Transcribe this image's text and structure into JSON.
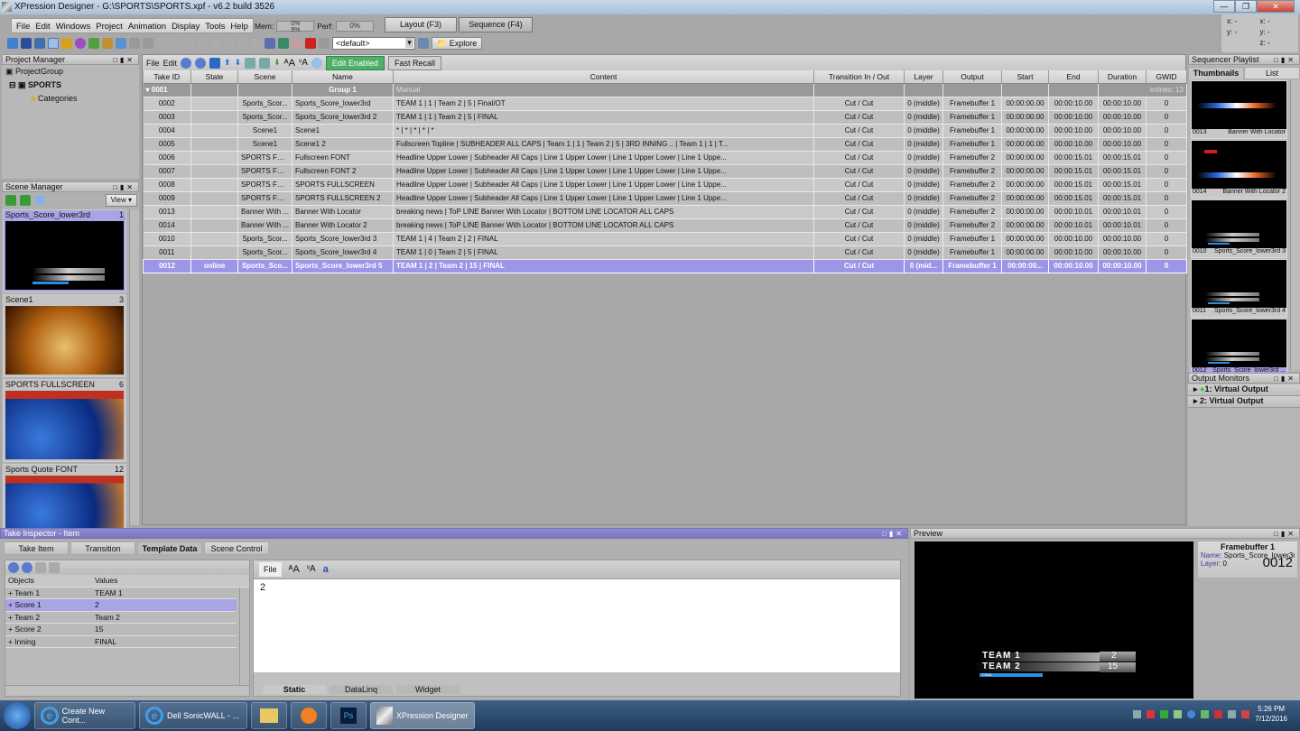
{
  "window": {
    "title": "XPression Designer - G:\\SPORTS\\SPORTS.xpf - v6.2 build 3526",
    "min": "—",
    "max": "❐",
    "close": "✕"
  },
  "menu": [
    "File",
    "Edit",
    "Windows",
    "Project",
    "Animation",
    "Display",
    "Tools",
    "Help"
  ],
  "meters": {
    "mem_label": "Mem:",
    "mem_top": "0%",
    "mem_bottom": "9%",
    "perf_label": "Perf:",
    "perf_value": "0%"
  },
  "modes": {
    "layout": "Layout (F3)",
    "sequence": "Sequence (F4)"
  },
  "toolbar": {
    "combo_value": "<default>",
    "explore": "Explore"
  },
  "coords": {
    "x1": "x: -",
    "x2": "x: -",
    "y1": "y: -",
    "y2": "y: -",
    "z2": "z: -"
  },
  "project_manager": {
    "title": "Project Manager",
    "items": [
      "ProjectGroup",
      "SPORTS",
      "Categories"
    ]
  },
  "scene_manager": {
    "title": "Scene Manager",
    "view": "View ▾",
    "scenes": [
      {
        "name": "Sports_Score_lower3rd",
        "num": "1"
      },
      {
        "name": "Scene1",
        "num": "3"
      },
      {
        "name": "SPORTS FULLSCREEN",
        "num": "6"
      },
      {
        "name": "Sports Quote FONT",
        "num": "12"
      }
    ]
  },
  "take_list": {
    "toolbar": {
      "file": "File",
      "edit": "Edit",
      "edit_enabled": "Edit Enabled",
      "fast_recall": "Fast Recall"
    },
    "columns": [
      "Take ID",
      "State",
      "Scene",
      "Name",
      "Content",
      "Transition In / Out",
      "Layer",
      "Output",
      "Start",
      "End",
      "Duration",
      "GWID"
    ],
    "group": {
      "id": "0001",
      "name": "Group 1",
      "content": "Manual",
      "entries": "entries: 13"
    },
    "rows": [
      [
        "0002",
        "",
        "Sports_Scor...",
        "Sports_Score_lower3rd",
        "TEAM 1 | 1 | Team 2 | 5 | Final/OT",
        "Cut / Cut",
        "0 (middle)",
        "Framebuffer 1",
        "00:00:00.00",
        "00:00:10.00",
        "00:00:10.00",
        "0"
      ],
      [
        "0003",
        "",
        "Sports_Scor...",
        "Sports_Score_lower3rd 2",
        "TEAM 1 | 1 | Team 2 | 5 | FINAL",
        "Cut / Cut",
        "0 (middle)",
        "Framebuffer 1",
        "00:00:00.00",
        "00:00:10.00",
        "00:00:10.00",
        "0"
      ],
      [
        "0004",
        "",
        "Scene1",
        "Scene1",
        "* | * | * | * | *",
        "Cut / Cut",
        "0 (middle)",
        "Framebuffer 1",
        "00:00:00.00",
        "00:00:10.00",
        "00:00:10.00",
        "0"
      ],
      [
        "0005",
        "",
        "Scene1",
        "Scene1 2",
        "Fullscreen Topline | SUBHEADER ALL CAPS | Team 1 | 1 | Team 2 | 5 | 3RD INNING .. | Team 1 | 1 | T...",
        "Cut / Cut",
        "0 (middle)",
        "Framebuffer 1",
        "00:00:00.00",
        "00:00:10.00",
        "00:00:10.00",
        "0"
      ],
      [
        "0006",
        "",
        "SPORTS FUL...",
        "Fullscreen FONT",
        "Headline Upper Lower | Subheader All Caps | Line 1 Upper Lower | Line 1 Upper Lower | Line 1 Uppe...",
        "Cut / Cut",
        "0 (middle)",
        "Framebuffer 2",
        "00:00:00.00",
        "00:00:15.01",
        "00:00:15.01",
        "0"
      ],
      [
        "0007",
        "",
        "SPORTS FUL...",
        "Fullscreen FONT 2",
        "Headline Upper Lower | Subheader All Caps | Line 1 Upper Lower | Line 1 Upper Lower | Line 1 Uppe...",
        "Cut / Cut",
        "0 (middle)",
        "Framebuffer 2",
        "00:00:00.00",
        "00:00:15.01",
        "00:00:15.01",
        "0"
      ],
      [
        "0008",
        "",
        "SPORTS FUL...",
        "SPORTS FULLSCREEN",
        "Headline Upper Lower | Subheader All Caps | Line 1 Upper Lower | Line 1 Upper Lower | Line 1 Uppe...",
        "Cut / Cut",
        "0 (middle)",
        "Framebuffer 2",
        "00:00:00.00",
        "00:00:15.01",
        "00:00:15.01",
        "0"
      ],
      [
        "0009",
        "",
        "SPORTS FUL...",
        "SPORTS FULLSCREEN 2",
        "Headline Upper Lower | Subheader All Caps | Line 1 Upper Lower | Line 1 Upper Lower | Line 1 Uppe...",
        "Cut / Cut",
        "0 (middle)",
        "Framebuffer 2",
        "00:00:00.00",
        "00:00:15.01",
        "00:00:15.01",
        "0"
      ],
      [
        "0013",
        "",
        "Banner With ...",
        "Banner With Locator",
        "breaking news | ToP LINE Banner With Locator | BOTTOM LINE LOCATOR ALL CAPS",
        "Cut / Cut",
        "0 (middle)",
        "Framebuffer 2",
        "00:00:00.00",
        "00:00:10.01",
        "00:00:10.01",
        "0"
      ],
      [
        "0014",
        "",
        "Banner With ...",
        "Banner With Locator 2",
        "breaking news | ToP LINE Banner With Locator | BOTTOM LINE LOCATOR ALL CAPS",
        "Cut / Cut",
        "0 (middle)",
        "Framebuffer 2",
        "00:00:00.00",
        "00:00:10.01",
        "00:00:10.01",
        "0"
      ],
      [
        "0010",
        "",
        "Sports_Scor...",
        "Sports_Score_lower3rd 3",
        "TEAM 1 | 4 | Team 2 | 2 | FINAL",
        "Cut / Cut",
        "0 (middle)",
        "Framebuffer 1",
        "00:00:00.00",
        "00:00:10.00",
        "00:00:10.00",
        "0"
      ],
      [
        "0011",
        "",
        "Sports_Scor...",
        "Sports_Score_lower3rd 4",
        "TEAM 1 | 0 | Team 2 | 5 | FINAL",
        "Cut / Cut",
        "0 (middle)",
        "Framebuffer 1",
        "00:00:00.00",
        "00:00:10.00",
        "00:00:10.00",
        "0"
      ],
      [
        "0012",
        "online",
        "Sports_Sco...",
        "Sports_Score_lower3rd 5",
        "TEAM 1 |  2 | Team 2 | 15 | FINAL",
        "Cut / Cut",
        "0 (mid...",
        "Framebuffer 1",
        "00:00:00...",
        "00:00:10.00",
        "00:00:10.00",
        "0"
      ]
    ],
    "selected_id": "0012"
  },
  "sequencer": {
    "title": "Sequencer Playlist",
    "tabs": [
      "Thumbnails",
      "List"
    ],
    "items": [
      {
        "id": "0013",
        "name": "Banner With Locator"
      },
      {
        "id": "0014",
        "name": "Banner With Locator 2"
      },
      {
        "id": "0010",
        "name": "Sports_Score_lower3rd 3"
      },
      {
        "id": "0011",
        "name": "Sports_Score_lower3rd 4"
      },
      {
        "id": "0012",
        "name": "Sports_Score_lower3rd ..."
      }
    ]
  },
  "output_monitors": {
    "title": "Output Monitors",
    "items": [
      "1: Virtual Output",
      "2: Virtual Output"
    ]
  },
  "take_inspector": {
    "title": "Take Inspector - Item",
    "tabs": [
      "Take Item",
      "Transition",
      "Template Data",
      "Scene Control"
    ],
    "active_tab": "Template Data",
    "columns": [
      "Objects",
      "Values"
    ],
    "objects": [
      {
        "name": "Team 1",
        "value": "TEAM 1"
      },
      {
        "name": "Score 1",
        "value": " 2"
      },
      {
        "name": "Team 2",
        "value": "Team 2"
      },
      {
        "name": "Score 2",
        "value": "15"
      },
      {
        "name": "Inning",
        "value": "FINAL"
      }
    ],
    "editor_file": "File",
    "editor_text": "2",
    "editor_tabs": [
      "Static",
      "DataLinq",
      "Widget"
    ]
  },
  "preview": {
    "title": "Preview",
    "framebuffer": "Framebuffer 1",
    "name_label": "Name:",
    "name_value": "Sports_Score_lower3rd",
    "layer_label": "Layer:",
    "layer_value": "0",
    "take_id": "0012",
    "graphic": {
      "team1": "TEAM 1",
      "team2": "TEAM 2",
      "score1": "2",
      "score2": "15",
      "inning": "FINAL"
    }
  },
  "taskbar": {
    "items": [
      "Create New Cont...",
      "Dell SonicWALL - ...",
      "XPression Designer"
    ],
    "time": "5:26 PM",
    "date": "7/12/2016"
  },
  "colors": {
    "selection": "#9c96e8",
    "edit_enabled": "#4fae6a",
    "inspector_header": "#7b77c0"
  }
}
